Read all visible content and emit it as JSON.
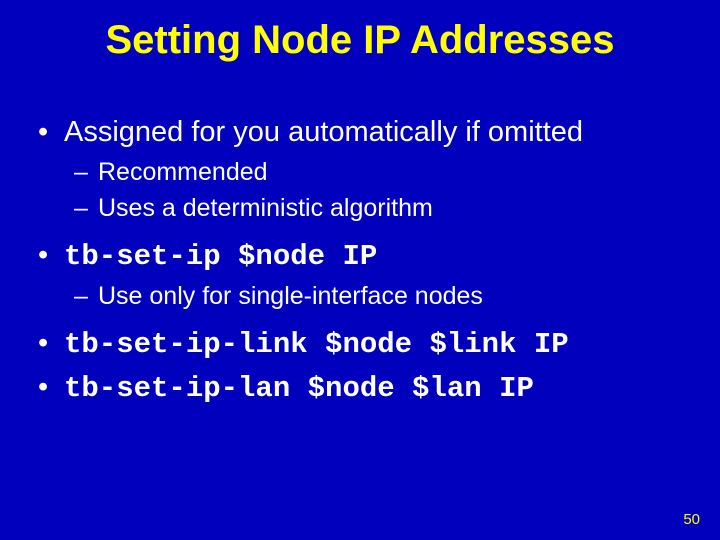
{
  "title": "Setting Node IP Addresses",
  "bullets": {
    "b0": {
      "text": "Assigned for you automatically if omitted",
      "sub": {
        "s0": "Recommended",
        "s1": "Uses a deterministic algorithm"
      }
    },
    "b1": {
      "text": "tb-set-ip $node IP",
      "sub": {
        "s0": "Use only for single-interface nodes"
      }
    },
    "b2": {
      "text": "tb-set-ip-link $node $link IP"
    },
    "b3": {
      "text": "tb-set-ip-lan $node $lan IP"
    }
  },
  "page_number": "50"
}
